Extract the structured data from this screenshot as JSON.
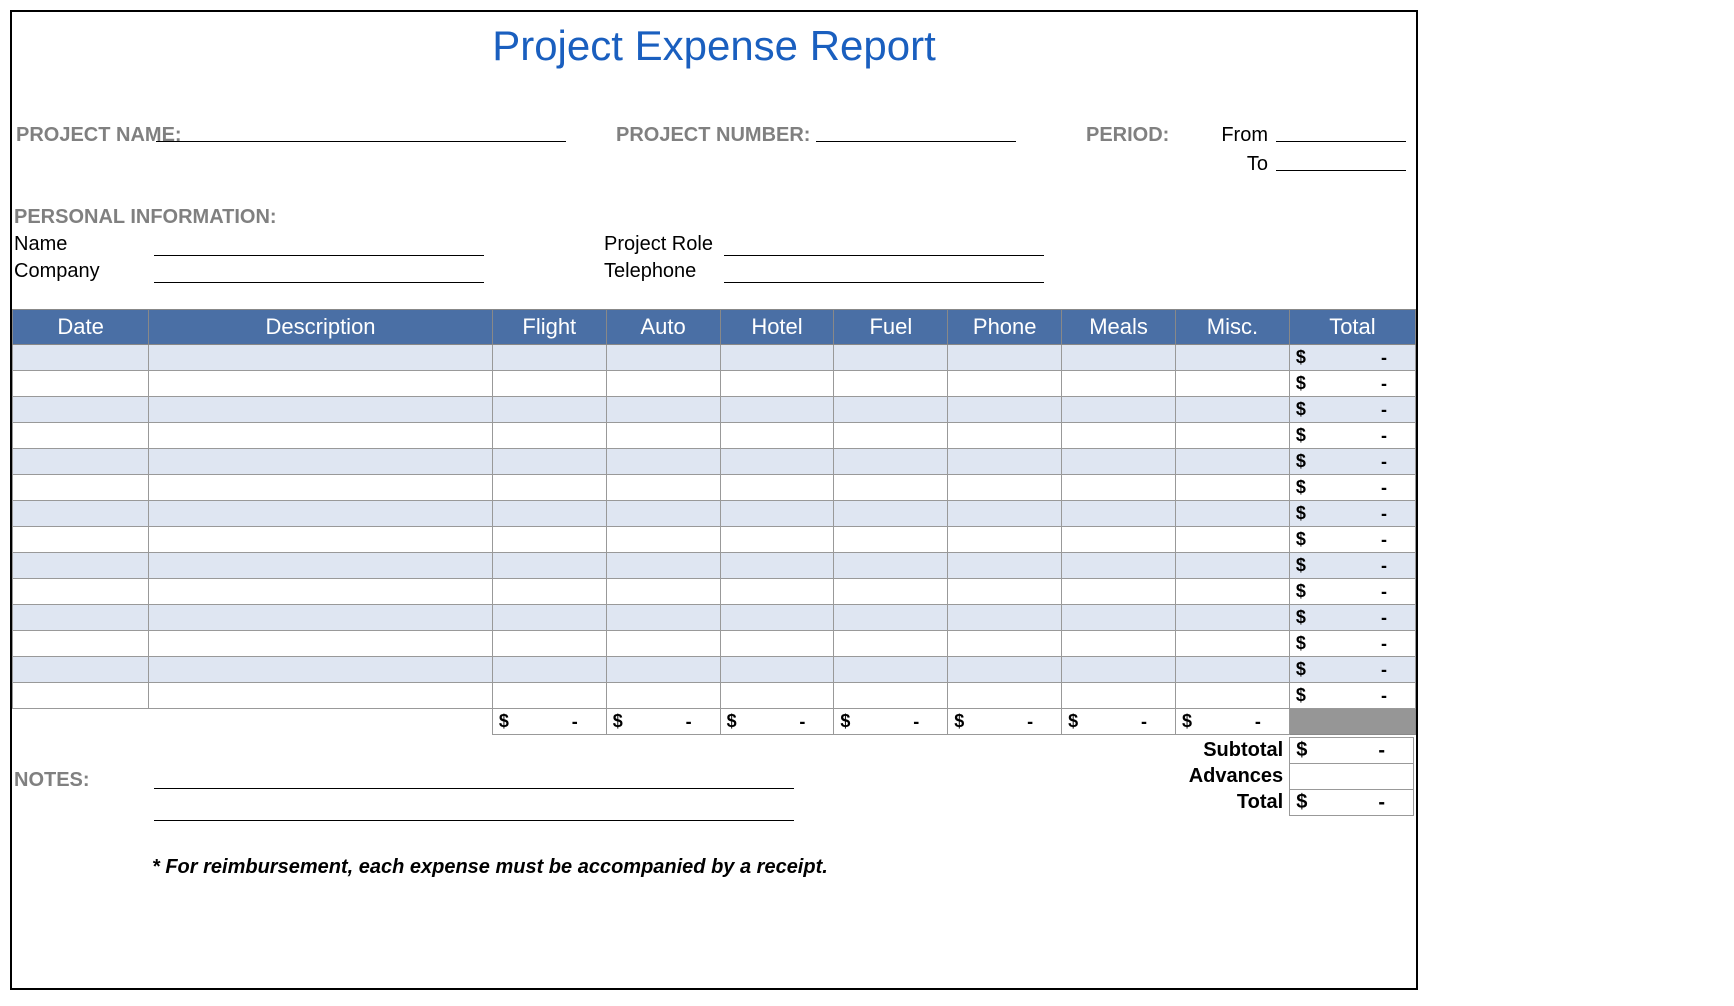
{
  "title": "Project Expense Report",
  "labels": {
    "project_name": "PROJECT NAME:",
    "project_number": "PROJECT NUMBER:",
    "period": "PERIOD:",
    "from": "From",
    "to": "To",
    "personal_info": "PERSONAL INFORMATION:",
    "name": "Name",
    "company": "Company",
    "project_role": "Project Role",
    "telephone": "Telephone",
    "notes": "NOTES:"
  },
  "columns": {
    "date": "Date",
    "description": "Description",
    "flight": "Flight",
    "auto": "Auto",
    "hotel": "Hotel",
    "fuel": "Fuel",
    "phone": "Phone",
    "meals": "Meals",
    "misc": "Misc.",
    "total": "Total"
  },
  "row_total": {
    "currency": "$",
    "value": "-"
  },
  "column_totals": {
    "currency": "$",
    "value": "-"
  },
  "summary": {
    "subtotal_label": "Subtotal",
    "advances_label": "Advances",
    "total_label": "Total",
    "subtotal": {
      "currency": "$",
      "value": "-"
    },
    "advances": {
      "currency": "",
      "value": ""
    },
    "total": {
      "currency": "$",
      "value": "-"
    }
  },
  "footnote": "* For reimbursement, each expense must be accompanied by a receipt.",
  "num_rows": 14
}
